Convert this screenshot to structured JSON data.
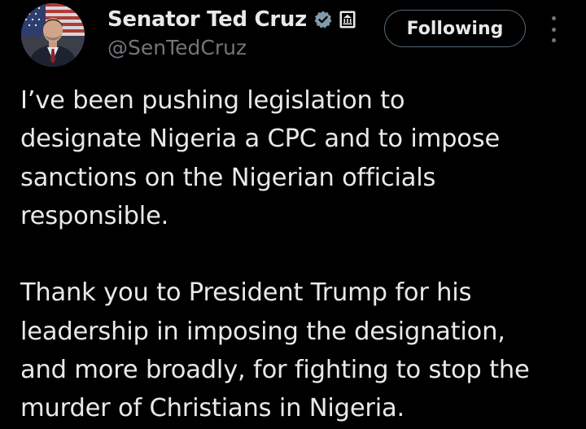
{
  "author": {
    "display_name": "Senator Ted Cruz",
    "handle": "@SenTedCruz",
    "verified_icon": "verified-badge-icon",
    "affiliation_icon": "government-building-icon",
    "avatar_icon": "profile-photo"
  },
  "actions": {
    "follow_label": "Following",
    "more_icon": "more-options-icon"
  },
  "tweet": {
    "paragraph1": [
      "I’ve been pushing legislation to",
      "designate Nigeria a CPC and to impose",
      "sanctions on the Nigerian officials",
      "responsible."
    ],
    "paragraph2": [
      "Thank you to President Trump for his",
      "leadership in imposing the designation,",
      "and more broadly, for fighting to stop the",
      "murder of Christians in Nigeria."
    ]
  },
  "colors": {
    "background": "#000000",
    "text_primary": "#e7e9ea",
    "text_secondary": "#71767b",
    "verified": "#829aab",
    "button_border": "#536471"
  }
}
